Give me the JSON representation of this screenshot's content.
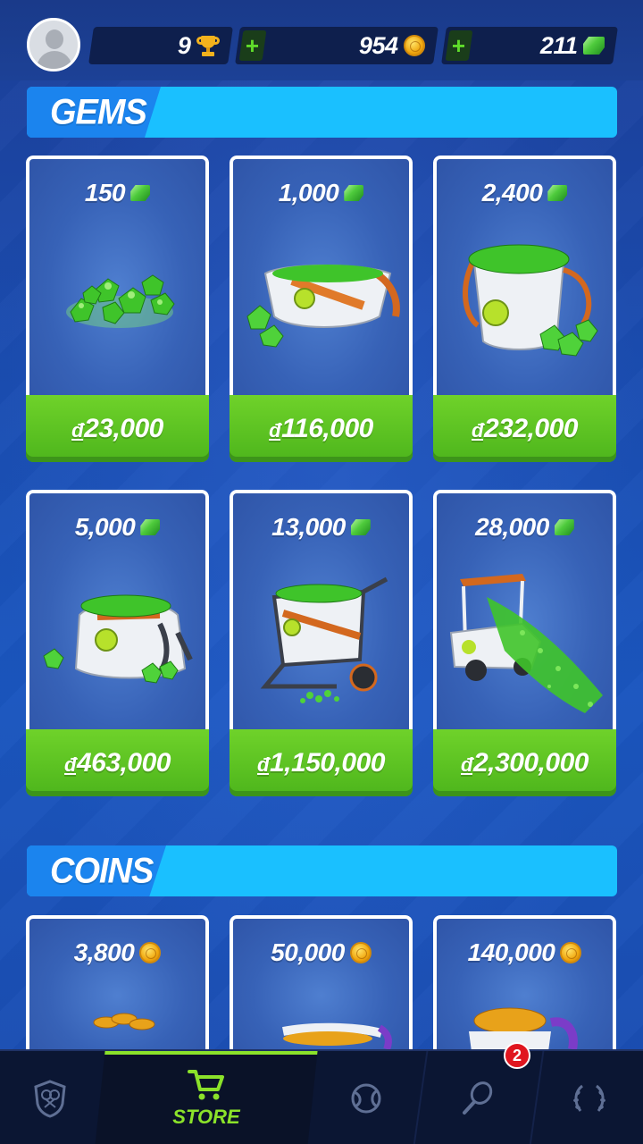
{
  "header": {
    "trophies": "9",
    "coins": "954",
    "gems": "211",
    "plus_symbol": "+"
  },
  "sections": {
    "gems_title": "GEMS",
    "coins_title": "COINS"
  },
  "gem_packs": [
    {
      "amount": "150",
      "currency_symbol": "đ",
      "price": "23,000"
    },
    {
      "amount": "1,000",
      "currency_symbol": "đ",
      "price": "116,000"
    },
    {
      "amount": "2,400",
      "currency_symbol": "đ",
      "price": "232,000"
    },
    {
      "amount": "5,000",
      "currency_symbol": "đ",
      "price": "463,000"
    },
    {
      "amount": "13,000",
      "currency_symbol": "đ",
      "price": "1,150,000"
    },
    {
      "amount": "28,000",
      "currency_symbol": "đ",
      "price": "2,300,000"
    }
  ],
  "coin_packs": [
    {
      "amount": "3,800"
    },
    {
      "amount": "50,000"
    },
    {
      "amount": "140,000"
    }
  ],
  "nav": {
    "items": [
      {
        "id": "club",
        "icon": "shield-racket-icon"
      },
      {
        "id": "store",
        "icon": "cart-icon",
        "label": "STORE"
      },
      {
        "id": "play",
        "icon": "tennis-ball-icon"
      },
      {
        "id": "rackets",
        "icon": "racket-icon",
        "badge": "2"
      },
      {
        "id": "rank",
        "icon": "laurel-icon"
      }
    ],
    "active_color": "#8be22a"
  },
  "colors": {
    "price_green": "#5cc420",
    "header_cyan": "#1ac0ff",
    "header_tab_blue": "#1b84ee"
  }
}
